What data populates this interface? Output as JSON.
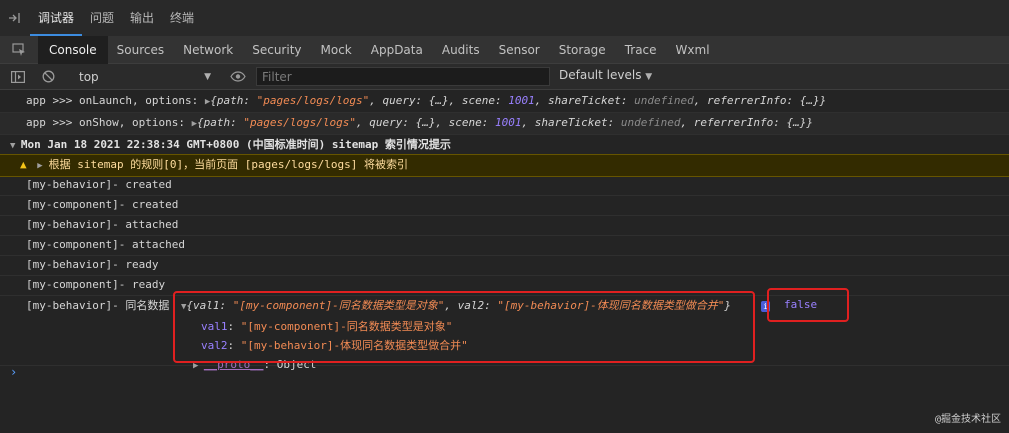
{
  "topbar": {
    "tabs": [
      "调试器",
      "问题",
      "输出",
      "终端"
    ]
  },
  "panels": [
    "Console",
    "Sources",
    "Network",
    "Security",
    "Mock",
    "AppData",
    "Audits",
    "Sensor",
    "Storage",
    "Trace",
    "Wxml"
  ],
  "filterbar": {
    "context": "top",
    "filter_placeholder": "Filter",
    "levels": "Default levels"
  },
  "console": {
    "launch": {
      "prefix": "app >>> onLaunch, options: ",
      "path_key": "path: ",
      "path_val": "\"pages/logs/logs\"",
      "query": ", query: {…}, scene: ",
      "scene": "1001",
      "share": ", shareTicket: ",
      "undef": "undefined",
      "ref": ", referrerInfo: {…}}"
    },
    "show": {
      "prefix": "app >>> onShow, options: ",
      "path_key": "path: ",
      "path_val": "\"pages/logs/logs\"",
      "query": ", query: {…}, scene: ",
      "scene": "1001",
      "share": ", shareTicket: ",
      "undef": "undefined",
      "ref": ", referrerInfo: {…}}"
    },
    "group_header": "Mon Jan 18 2021 22:38:34 GMT+0800 (中国标准时间) sitemap 索引情况提示",
    "warning": "根据 sitemap 的规则[0]，当前页面 [pages/logs/logs] 将被索引",
    "logs": [
      "[my-behavior]- created",
      "[my-component]- created",
      "[my-behavior]- attached",
      "[my-component]- attached",
      "[my-behavior]- ready",
      "[my-component]- ready"
    ],
    "merge": {
      "label": "[my-behavior]- 同名数据",
      "summary_val1_key": "val1: ",
      "summary_val1": "\"[my-component]-同名数据类型是对象\"",
      "summary_val2_key": ", val2: ",
      "summary_val2": "\"[my-behavior]-体现同名数据类型做合并\"",
      "summary_close": "}",
      "val1_key": "val1",
      "val1": "\"[my-component]-同名数据类型是对象\"",
      "val2_key": "val2",
      "val2": "\"[my-behavior]-体现同名数据类型做合并\"",
      "proto_key": "__proto__",
      "proto_val": ": Object",
      "result": "false"
    }
  },
  "watermark": "@掘金技术社区",
  "colors": {
    "background": "#242424",
    "string": "#f28b54",
    "number": "#9980ff",
    "highlight_box": "#e02020"
  }
}
